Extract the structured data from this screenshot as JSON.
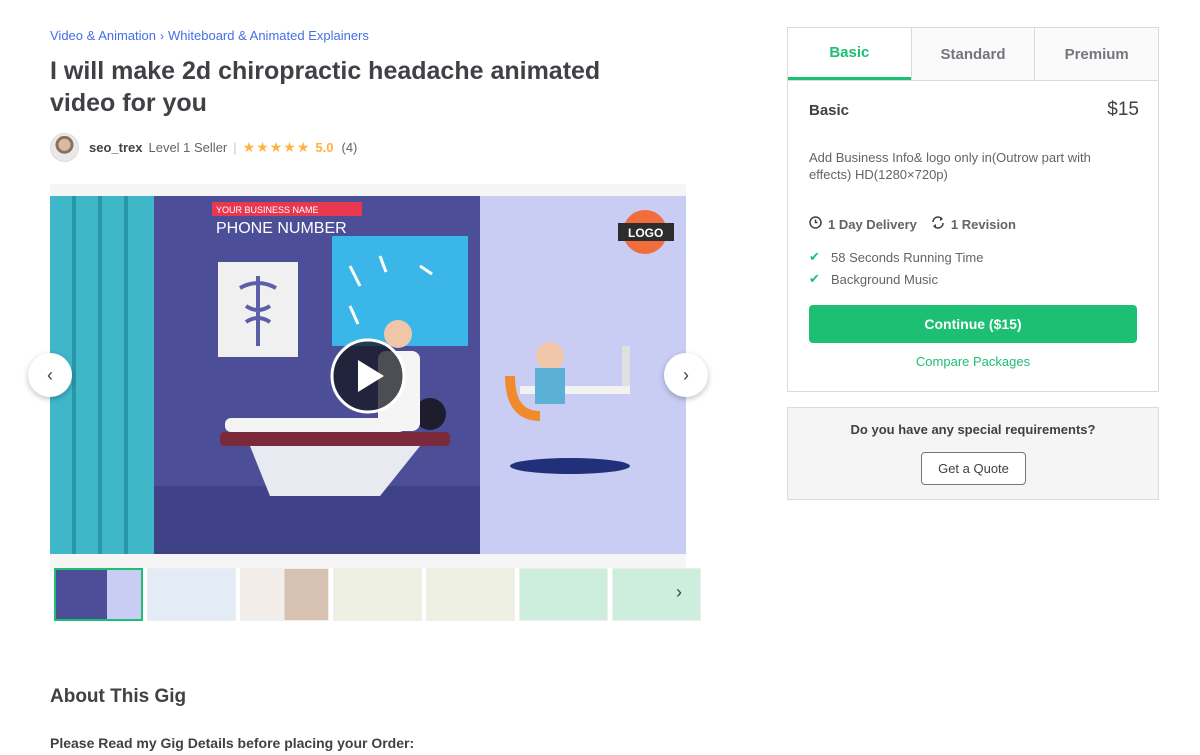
{
  "breadcrumb": {
    "category": "Video & Animation",
    "separator": "›",
    "subcategory": "Whiteboard & Animated Explainers"
  },
  "gig": {
    "title": "I will make 2d chiropractic headache animated video for you"
  },
  "seller": {
    "name": "seo_trex",
    "level": "Level 1 Seller",
    "separator": "|",
    "stars": "★★★★★",
    "rating": "5.0",
    "reviews": "(4)"
  },
  "gallery": {
    "image_texts": {
      "business_name": "YOUR BUSINESS NAME",
      "phone": "PHONE NUMBER",
      "logo": "LOGO"
    },
    "prev_icon": "‹",
    "next_icon": "›",
    "thumbs_next_icon": "›",
    "thumbnail_count": 8
  },
  "packages": {
    "tabs": [
      "Basic",
      "Standard",
      "Premium"
    ],
    "selected": {
      "name": "Basic",
      "price": "$15",
      "description": "Add Business Info& logo only in(Outrow part with effects) HD(1280×720p)",
      "delivery": "1 Day Delivery",
      "revisions": "1 Revision",
      "features": [
        "58 Seconds Running Time",
        "Background Music"
      ],
      "cta": "Continue ($15)",
      "compare": "Compare Packages"
    }
  },
  "requirements": {
    "question": "Do you have any special requirements?",
    "button": "Get a Quote"
  },
  "about": {
    "heading": "About This Gig",
    "intro": "Please Read my Gig Details before placing your Order:"
  },
  "colors": {
    "accent": "#1dbf73",
    "link": "#446ee7",
    "star": "#ffb33e",
    "text": "#404145"
  }
}
